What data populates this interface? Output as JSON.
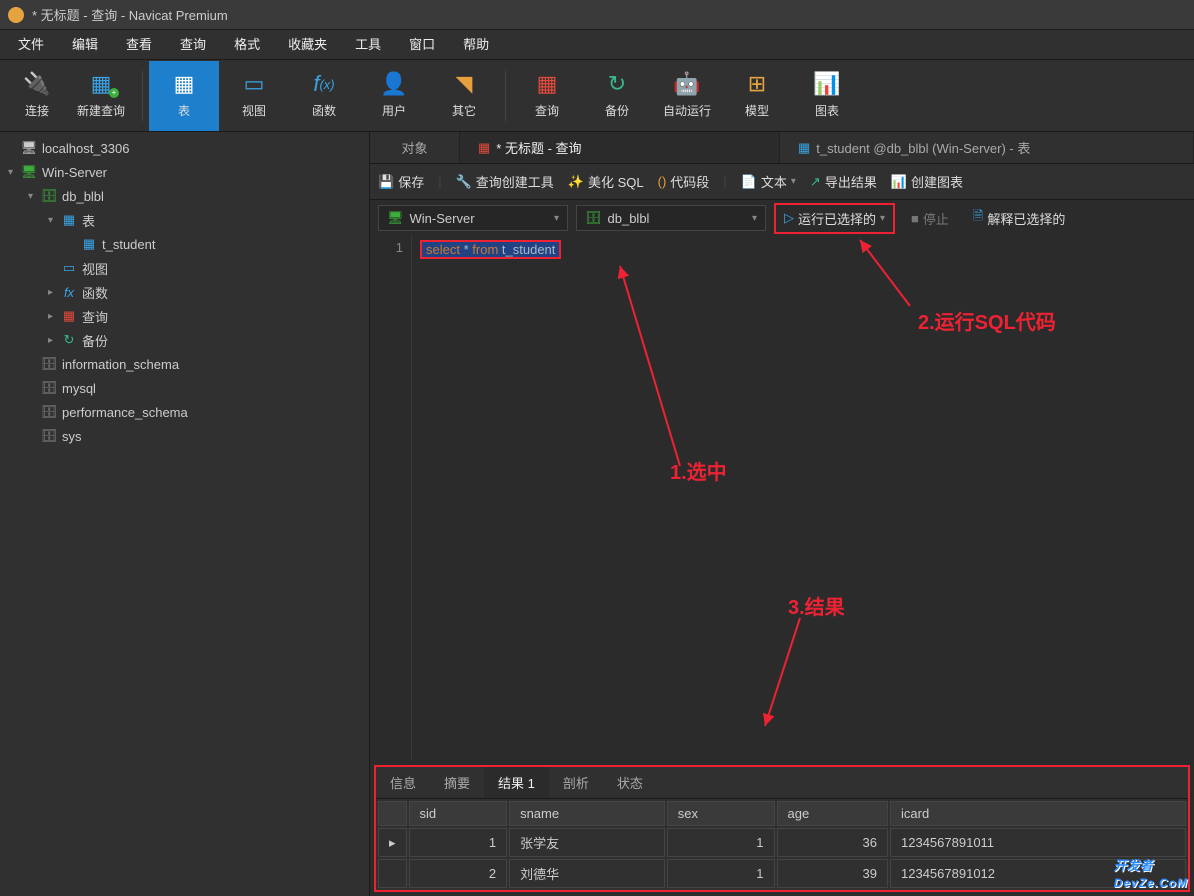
{
  "window": {
    "title": "* 无标题 - 查询 - Navicat Premium"
  },
  "menubar": [
    "文件",
    "编辑",
    "查看",
    "查询",
    "格式",
    "收藏夹",
    "工具",
    "窗口",
    "帮助"
  ],
  "toolbar": [
    {
      "label": "连接",
      "icon": "plug",
      "color": "#888"
    },
    {
      "label": "新建查询",
      "icon": "newq",
      "color": "#3aa3e3"
    },
    {
      "label": "表",
      "icon": "table",
      "color": "#fff",
      "active": true
    },
    {
      "label": "视图",
      "icon": "view",
      "color": "#3aa3e3"
    },
    {
      "label": "函数",
      "icon": "fx",
      "color": "#3aa3e3"
    },
    {
      "label": "用户",
      "icon": "user",
      "color": "#e69f3c"
    },
    {
      "label": "其它",
      "icon": "other",
      "color": "#e69f3c"
    },
    {
      "label": "查询",
      "icon": "query",
      "color": "#e24a3b"
    },
    {
      "label": "备份",
      "icon": "backup",
      "color": "#36b98f"
    },
    {
      "label": "自动运行",
      "icon": "robot",
      "color": "#36b98f"
    },
    {
      "label": "模型",
      "icon": "model",
      "color": "#e6a441"
    },
    {
      "label": "图表",
      "icon": "chart",
      "color": "#a15bd6"
    }
  ],
  "sidebar": {
    "items": [
      {
        "label": "localhost_3306",
        "type": "server",
        "lvl": 1,
        "toggle": ""
      },
      {
        "label": "Win-Server",
        "type": "server-green",
        "lvl": 1,
        "toggle": "▾"
      },
      {
        "label": "db_blbl",
        "type": "db",
        "lvl": 2,
        "toggle": "▾"
      },
      {
        "label": "表",
        "type": "folder",
        "lvl": 3,
        "toggle": "▾"
      },
      {
        "label": "t_student",
        "type": "table",
        "lvl": 4,
        "toggle": ""
      },
      {
        "label": "视图",
        "type": "view",
        "lvl": 3,
        "toggle": ""
      },
      {
        "label": "函数",
        "type": "fx",
        "lvl": 3,
        "toggle": "▸"
      },
      {
        "label": "查询",
        "type": "query",
        "lvl": 3,
        "toggle": "▸"
      },
      {
        "label": "备份",
        "type": "backup",
        "lvl": 3,
        "toggle": "▸"
      },
      {
        "label": "information_schema",
        "type": "db-gray",
        "lvl": 2,
        "toggle": ""
      },
      {
        "label": "mysql",
        "type": "db-gray",
        "lvl": 2,
        "toggle": ""
      },
      {
        "label": "performance_schema",
        "type": "db-gray",
        "lvl": 2,
        "toggle": ""
      },
      {
        "label": "sys",
        "type": "db-gray",
        "lvl": 2,
        "toggle": ""
      }
    ]
  },
  "tabs": [
    {
      "label": "对象",
      "active": false,
      "icon": ""
    },
    {
      "label": "* 无标题 - 查询",
      "active": true,
      "icon": "query"
    },
    {
      "label": "t_student @db_blbl (Win-Server) - 表",
      "active": false,
      "icon": "table"
    }
  ],
  "actions": {
    "save": "保存",
    "builder": "查询创建工具",
    "beautify": "美化 SQL",
    "snippet": "代码段",
    "text": "文本",
    "export": "导出结果",
    "chart": "创建图表"
  },
  "selectors": {
    "conn": "Win-Server",
    "db": "db_blbl",
    "run": "运行已选择的",
    "stop": "停止",
    "explain": "解释已选择的"
  },
  "editor": {
    "line": "1",
    "sql": {
      "kw1": "select",
      "star": "*",
      "kw2": "from",
      "tbl": "t_student"
    }
  },
  "result_tabs": [
    "信息",
    "摘要",
    "结果 1",
    "剖析",
    "状态"
  ],
  "result_active": 2,
  "result": {
    "cols": [
      "sid",
      "sname",
      "sex",
      "age",
      "icard"
    ],
    "rows": [
      {
        "handle": "▸",
        "sid": "1",
        "sname": "张学友",
        "sex": "1",
        "age": "36",
        "icard": "1234567891011"
      },
      {
        "handle": "",
        "sid": "2",
        "sname": "刘德华",
        "sex": "1",
        "age": "39",
        "icard": "1234567891012"
      }
    ]
  },
  "annotations": {
    "a1": "1.选中",
    "a2": "2.运行SQL代码",
    "a3": "3.结果"
  },
  "watermark": {
    "top": "开发者",
    "bot": "DevZe.CoM"
  }
}
